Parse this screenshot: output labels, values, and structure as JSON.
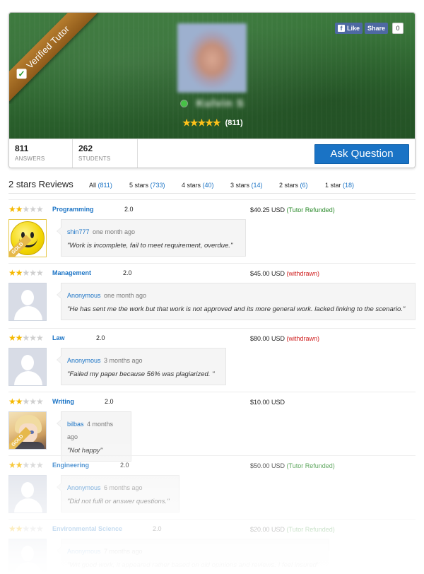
{
  "profile": {
    "verified_label": "Verified Tutor",
    "tutor_name": "Kulvin S",
    "rating_stars": 5,
    "rating_count": "(811)",
    "social": {
      "like_label": "Like",
      "share_label": "Share",
      "share_count": "0"
    },
    "stats": [
      {
        "value": "811",
        "label": "ANSWERS"
      },
      {
        "value": "262",
        "label": "STUDENTS"
      }
    ],
    "ask_button": "Ask Question"
  },
  "colors": {
    "accent": "#1a73c5",
    "hero_green": "#2f6a31",
    "ribbon": "#a06a22",
    "star": "#f5b800",
    "refunded": "#2a8a2a",
    "withdrawn": "#d02020"
  },
  "reviews_section": {
    "title": "2 stars Reviews",
    "filters": [
      {
        "label": "All",
        "count": "(811)"
      },
      {
        "label": "5 stars",
        "count": "(733)"
      },
      {
        "label": "4 stars",
        "count": "(40)"
      },
      {
        "label": "3 stars",
        "count": "(14)"
      },
      {
        "label": "2 stars",
        "count": "(6)"
      },
      {
        "label": "1 star",
        "count": "(18)"
      }
    ]
  },
  "reviews": [
    {
      "stars": 2,
      "subject": "Programming",
      "score": "2.0",
      "price": "$40.25 USD",
      "status": "(Tutor Refunded)",
      "author": "shin777",
      "when": "one month ago",
      "text": "\"Work is incomplete, fail to meet requirement, overdue.\"",
      "avatar": "smiley-gold-avatar",
      "avatar_badge": "GOLD"
    },
    {
      "stars": 2,
      "subject": "Management",
      "score": "2.0",
      "price": "$45.00 USD",
      "status": "(withdrawn)",
      "author": "Anonymous",
      "when": "one month ago",
      "text": "\"He has sent me the work but that work is not approved and its more general work. lacked linking to the scenario.\"",
      "avatar": "anonymous-avatar"
    },
    {
      "stars": 2,
      "subject": "Law",
      "score": "2.0",
      "price": "$80.00 USD",
      "status": "(withdrawn)",
      "author": "Anonymous",
      "when": "3 months ago",
      "text": "\"Failed my paper because 56% was plagiarized. \"",
      "avatar": "anonymous-avatar"
    },
    {
      "stars": 2,
      "subject": "Writing",
      "score": "2.0",
      "price": "$10.00 USD",
      "status": "",
      "author": "bilbas",
      "when": "4 months ago",
      "text": "\"Not happy\"",
      "avatar": "anime-gold-avatar",
      "avatar_badge": "GOLD"
    },
    {
      "stars": 2,
      "subject": "Engineering",
      "score": "2.0",
      "price": "$50.00 USD",
      "status": "(Tutor Refunded)",
      "author": "Anonymous",
      "when": "6 months ago",
      "text": "\"Did not fufil or answer questions.\"",
      "avatar": "anonymous-avatar"
    },
    {
      "stars": 2,
      "subject": "Environmental Science",
      "score": "2.0",
      "price": "$20.00 USD",
      "status": "(Tutor Refunded)",
      "author": "Anonymous",
      "when": "7 months ago",
      "text": "\"Wrt good work, it appeared rather based on old opinions and reviews. I feel insured\"",
      "avatar": "anonymous-avatar"
    }
  ]
}
